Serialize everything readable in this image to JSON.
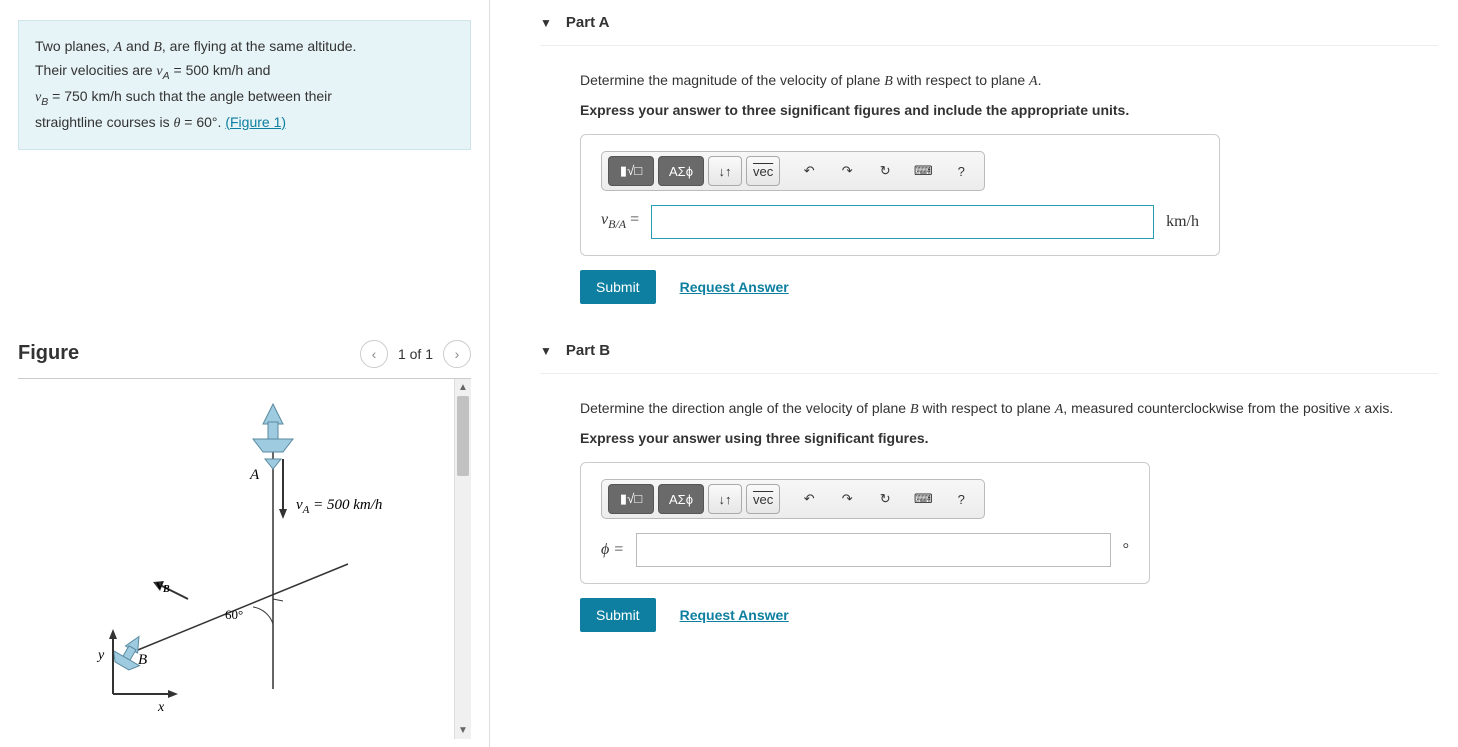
{
  "problem": {
    "line1_pre": "Two planes, ",
    "A": "A",
    "and": " and ",
    "B": "B",
    "line1_post": ", are flying at the same altitude.",
    "line2_pre": "Their velocities are ",
    "va_sym": "v",
    "va_sub": "A",
    "eq": " = ",
    "va_val": "500",
    "unit_kmh": " km/h",
    "and2": " and",
    "vb_sym": "v",
    "vb_sub": "B",
    "vb_val": "750",
    "line3_post": " such that the angle between their",
    "line4_pre": "straightline courses is ",
    "theta": "θ",
    "theta_val": " = 60°",
    "period": ". ",
    "figure_link": "(Figure 1)"
  },
  "figure": {
    "title": "Figure",
    "pager": "1 of 1",
    "labels": {
      "A": "A",
      "B": "B",
      "vB": "v",
      "vB_sub": "B",
      "vA_text": "v",
      "vA_sub": "A",
      "vA_val": " = 500 km/h",
      "angle": "60°",
      "x": "x",
      "y": "y"
    }
  },
  "partA": {
    "title": "Part A",
    "prompt_pre": "Determine the magnitude of the velocity of plane ",
    "B": "B",
    "prompt_mid": " with respect to plane ",
    "A": "A",
    "prompt_post": ".",
    "instruction": "Express your answer to three significant figures and include the appropriate units.",
    "label_v": "v",
    "label_sub": "B/A",
    "label_eq": " =",
    "unit": "km/h",
    "submit": "Submit",
    "request": "Request Answer"
  },
  "partB": {
    "title": "Part B",
    "prompt_pre": "Determine the direction angle of the velocity of plane ",
    "B": "B",
    "prompt_mid": " with respect to plane ",
    "A": "A",
    "prompt_post": ", measured counterclockwise from the positive ",
    "x": "x",
    "prompt_end": " axis.",
    "instruction": "Express your answer using three significant figures.",
    "label": "ϕ =",
    "unit": "°",
    "submit": "Submit",
    "request": "Request Answer"
  },
  "toolbar": {
    "templates": "▮√□",
    "greek": "ΑΣϕ",
    "subsup": "↓↑",
    "vec": "vec",
    "undo": "↶",
    "redo": "↷",
    "reset": "↻",
    "keyboard": "⌨",
    "help": "?"
  }
}
